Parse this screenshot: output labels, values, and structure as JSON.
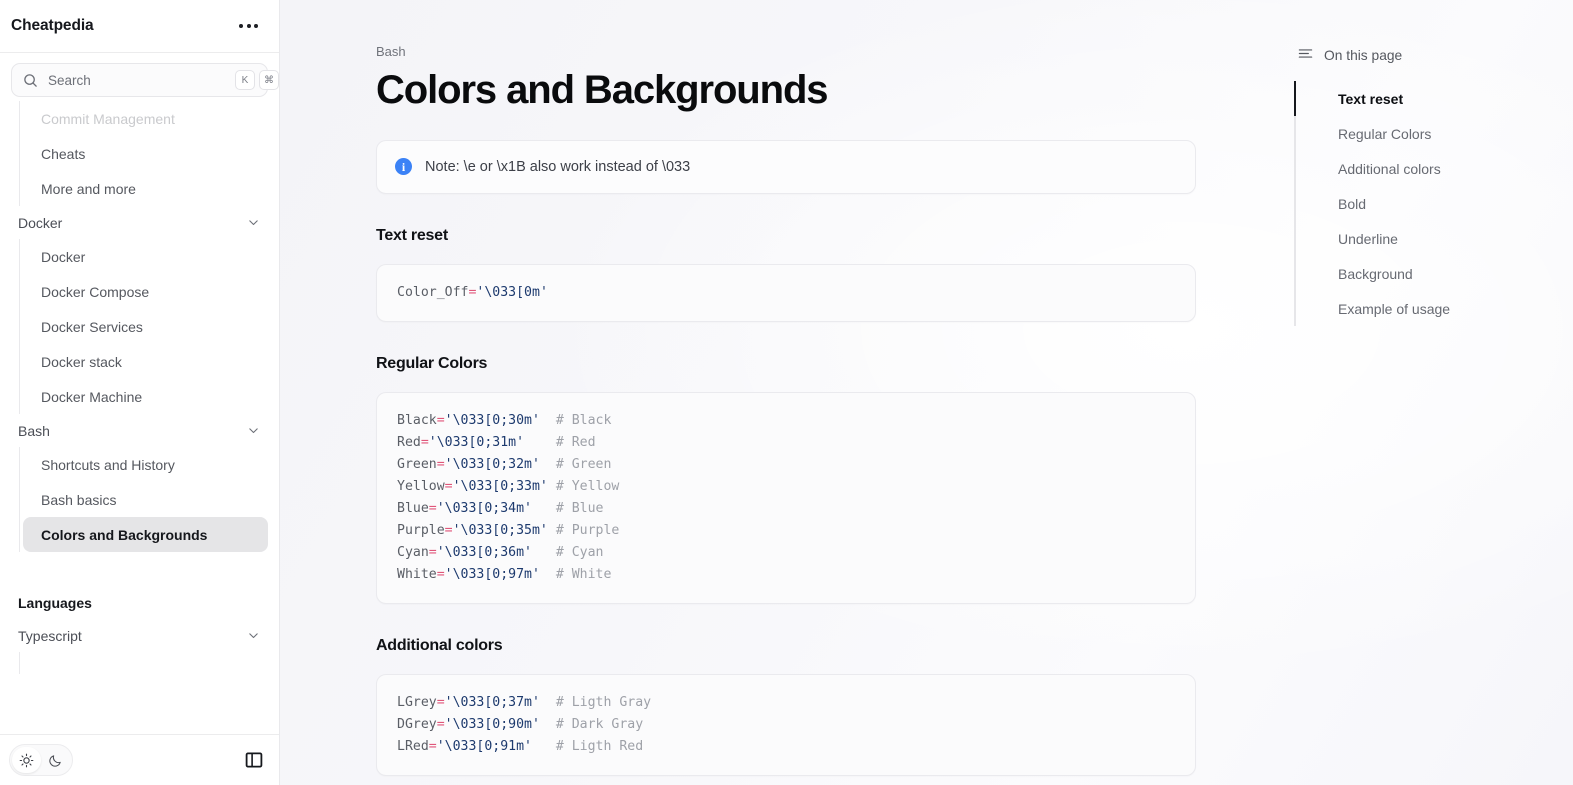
{
  "sidebar": {
    "brand": "Cheatpedia",
    "menu_icon": "ellipsis-icon",
    "search": {
      "placeholder": "Search",
      "value": "",
      "shortcut_key": "K",
      "shortcut_modifier": "⌘"
    },
    "nav": [
      {
        "type": "item",
        "label": "Commit Management",
        "state": "faded"
      },
      {
        "type": "item",
        "label": "Cheats",
        "state": "normal"
      },
      {
        "type": "item",
        "label": "More and more",
        "state": "normal"
      },
      {
        "type": "group",
        "label": "Docker",
        "expanded": true,
        "children": [
          {
            "label": "Docker"
          },
          {
            "label": "Docker Compose"
          },
          {
            "label": "Docker Services"
          },
          {
            "label": "Docker stack"
          },
          {
            "label": "Docker Machine"
          }
        ]
      },
      {
        "type": "group",
        "label": "Bash",
        "expanded": true,
        "children": [
          {
            "label": "Shortcuts and History"
          },
          {
            "label": "Bash basics"
          },
          {
            "label": "Colors and Backgrounds",
            "active": true
          }
        ]
      },
      {
        "type": "section",
        "label": "Languages"
      },
      {
        "type": "group",
        "label": "Typescript",
        "expanded": true,
        "children": []
      }
    ],
    "footer": {
      "theme_light": "sun-icon",
      "theme_dark": "moon-icon",
      "active_theme": "light",
      "panel_toggle": "sidebar-toggle-icon"
    }
  },
  "main": {
    "breadcrumb": "Bash",
    "title": "Colors and Backgrounds",
    "callout": {
      "icon": "info-icon",
      "text": "Note: \\e or \\x1B also work instead of \\033"
    },
    "sections": [
      {
        "heading": "Text reset",
        "lines": [
          {
            "var": "Color_Off",
            "op": "=",
            "str": "'\\033[0m'",
            "pad": "",
            "cmt": ""
          }
        ]
      },
      {
        "heading": "Regular Colors",
        "lines": [
          {
            "var": "Black",
            "op": "=",
            "str": "'\\033[0;30m'",
            "pad": "  ",
            "cmt": "# Black"
          },
          {
            "var": "Red",
            "op": "=",
            "str": "'\\033[0;31m'",
            "pad": "    ",
            "cmt": "# Red"
          },
          {
            "var": "Green",
            "op": "=",
            "str": "'\\033[0;32m'",
            "pad": "  ",
            "cmt": "# Green"
          },
          {
            "var": "Yellow",
            "op": "=",
            "str": "'\\033[0;33m'",
            "pad": " ",
            "cmt": "# Yellow"
          },
          {
            "var": "Blue",
            "op": "=",
            "str": "'\\033[0;34m'",
            "pad": "   ",
            "cmt": "# Blue"
          },
          {
            "var": "Purple",
            "op": "=",
            "str": "'\\033[0;35m'",
            "pad": " ",
            "cmt": "# Purple"
          },
          {
            "var": "Cyan",
            "op": "=",
            "str": "'\\033[0;36m'",
            "pad": "   ",
            "cmt": "# Cyan"
          },
          {
            "var": "White",
            "op": "=",
            "str": "'\\033[0;97m'",
            "pad": "  ",
            "cmt": "# White"
          }
        ]
      },
      {
        "heading": "Additional colors",
        "lines": [
          {
            "var": "LGrey",
            "op": "=",
            "str": "'\\033[0;37m'",
            "pad": "  ",
            "cmt": "# Ligth Gray"
          },
          {
            "var": "DGrey",
            "op": "=",
            "str": "'\\033[0;90m'",
            "pad": "  ",
            "cmt": "# Dark Gray"
          },
          {
            "var": "LRed",
            "op": "=",
            "str": "'\\033[0;91m'",
            "pad": "   ",
            "cmt": "# Ligth Red"
          }
        ]
      }
    ]
  },
  "toc": {
    "icon": "list-icon",
    "title": "On this page",
    "items": [
      {
        "label": "Text reset",
        "active": true
      },
      {
        "label": "Regular Colors",
        "active": false
      },
      {
        "label": "Additional colors",
        "active": false
      },
      {
        "label": "Bold",
        "active": false
      },
      {
        "label": "Underline",
        "active": false
      },
      {
        "label": "Background",
        "active": false
      },
      {
        "label": "Example of usage",
        "active": false
      }
    ]
  },
  "colors": {
    "accent_info": "#3b82f6",
    "active_pill": "#e5e5e7",
    "code_operator": "#e0567a",
    "code_string": "#1d3a6e",
    "code_comment": "#9ea1a8",
    "text_primary": "#16181d",
    "text_muted": "#70737b"
  }
}
